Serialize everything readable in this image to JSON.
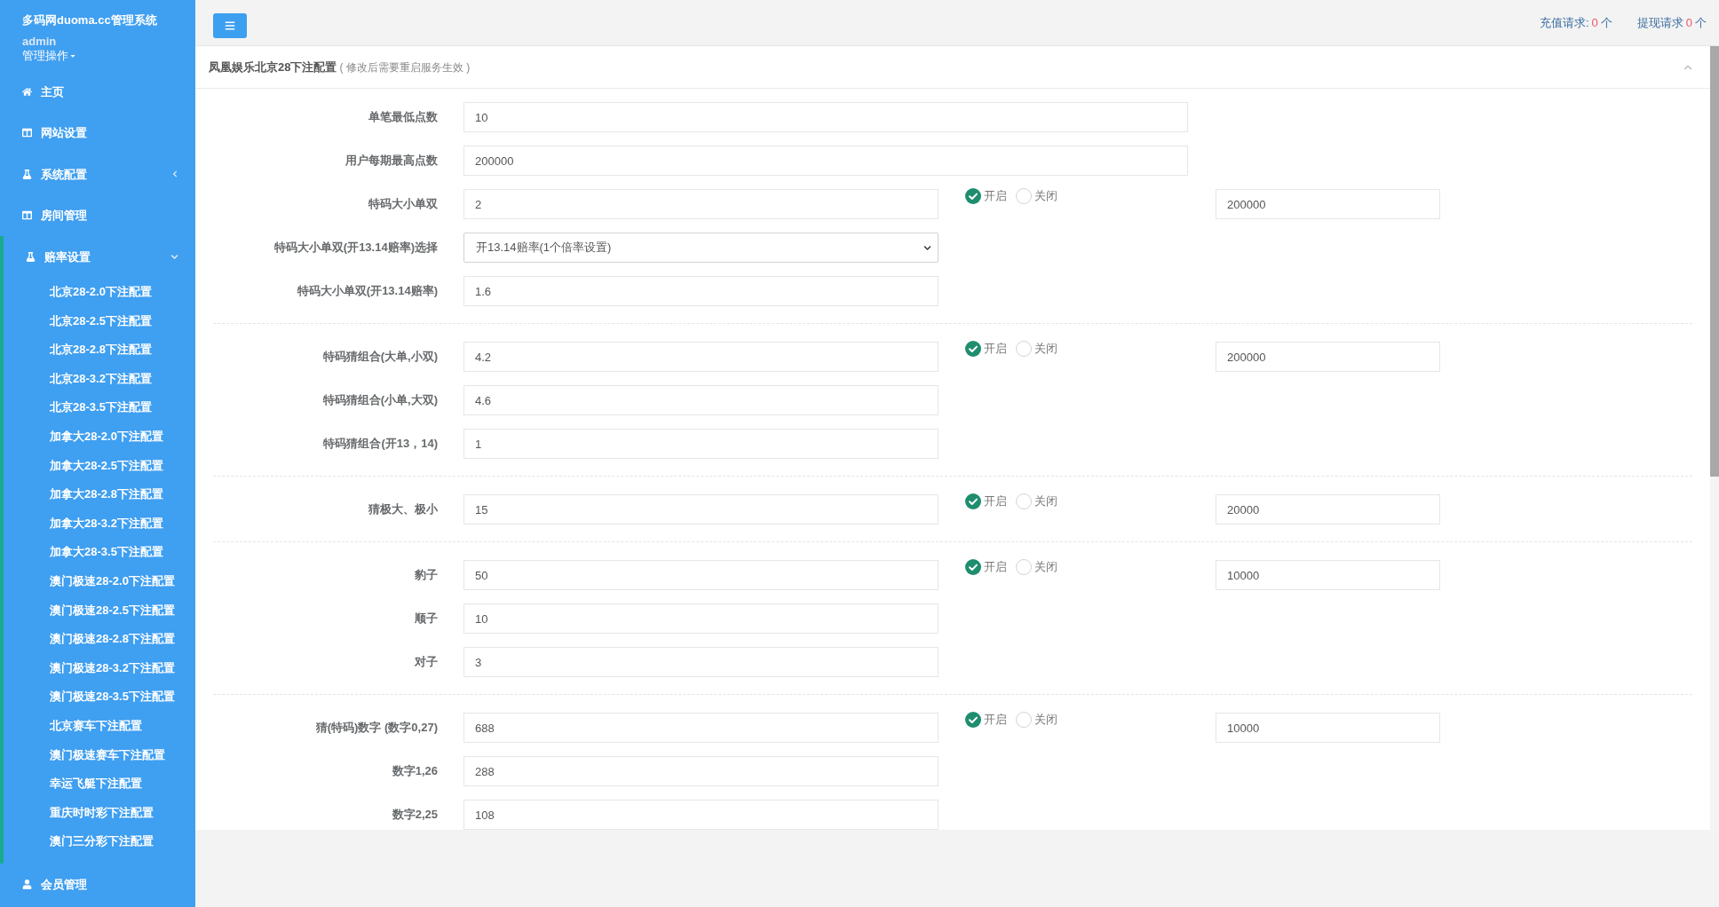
{
  "sidebar": {
    "brand": "多码网duoma.cc管理系统",
    "user": "admin",
    "user_menu": "管理操作",
    "items": [
      {
        "label": "主页",
        "kind": "link"
      },
      {
        "label": "网站设置",
        "kind": "link"
      },
      {
        "label": "系统配置",
        "kind": "menu",
        "expanded": false
      },
      {
        "label": "房间管理",
        "kind": "link"
      },
      {
        "label": "赔率设置",
        "kind": "menu",
        "expanded": true,
        "children": [
          {
            "label": "北京28-2.0下注配置"
          },
          {
            "label": "北京28-2.5下注配置"
          },
          {
            "label": "北京28-2.8下注配置"
          },
          {
            "label": "北京28-3.2下注配置"
          },
          {
            "label": "北京28-3.5下注配置"
          },
          {
            "label": "加拿大28-2.0下注配置"
          },
          {
            "label": "加拿大28-2.5下注配置"
          },
          {
            "label": "加拿大28-2.8下注配置"
          },
          {
            "label": "加拿大28-3.2下注配置"
          },
          {
            "label": "加拿大28-3.5下注配置"
          },
          {
            "label": "澳门极速28-2.0下注配置"
          },
          {
            "label": "澳门极速28-2.5下注配置"
          },
          {
            "label": "澳门极速28-2.8下注配置"
          },
          {
            "label": "澳门极速28-3.2下注配置"
          },
          {
            "label": "澳门极速28-3.5下注配置"
          },
          {
            "label": "北京赛车下注配置"
          },
          {
            "label": "澳门极速赛车下注配置"
          },
          {
            "label": "幸运飞艇下注配置"
          },
          {
            "label": "重庆时时彩下注配置"
          },
          {
            "label": "澳门三分彩下注配置"
          }
        ]
      },
      {
        "label": "会员管理",
        "kind": "link"
      }
    ]
  },
  "topbar": {
    "requests": [
      {
        "label": "充值请求:",
        "count": "0",
        "unit": "个"
      },
      {
        "label": "提现请求",
        "count": "0",
        "unit": "个"
      }
    ]
  },
  "panel": {
    "title": "凤凰娱乐北京28下注配置",
    "note": "( 修改后需要重启服务生效 )",
    "general": [
      {
        "label": "单笔最低点数",
        "value": "10"
      },
      {
        "label": "用户每期最高点数",
        "value": "200000"
      }
    ],
    "groups": [
      {
        "rows": [
          {
            "label": "特码大小单双",
            "kind": "input",
            "value": "2"
          },
          {
            "label": "特码大小单双(开13.14赔率)选择",
            "kind": "select",
            "value": "开13.14赔率(1个倍率设置)"
          },
          {
            "label": "特码大小单双(开13.14赔率)",
            "kind": "input",
            "value": "1.6"
          }
        ],
        "switch": [
          {
            "label": "开启",
            "selected": true
          },
          {
            "label": "关闭",
            "selected": false
          }
        ],
        "limit": "200000"
      },
      {
        "rows": [
          {
            "label": "特码猜组合(大单,小双)",
            "kind": "input",
            "value": "4.2"
          },
          {
            "label": "特码猜组合(小单,大双)",
            "kind": "input",
            "value": "4.6"
          },
          {
            "label": "特码猜组合(开13，14)",
            "kind": "input",
            "value": "1"
          }
        ],
        "switch": [
          {
            "label": "开启",
            "selected": true
          },
          {
            "label": "关闭",
            "selected": false
          }
        ],
        "limit": "200000"
      },
      {
        "rows": [
          {
            "label": "猜极大、极小",
            "kind": "input",
            "value": "15"
          }
        ],
        "switch": [
          {
            "label": "开启",
            "selected": true
          },
          {
            "label": "关闭",
            "selected": false
          }
        ],
        "limit": "20000"
      },
      {
        "rows": [
          {
            "label": "豹子",
            "kind": "input",
            "value": "50"
          },
          {
            "label": "顺子",
            "kind": "input",
            "value": "10"
          },
          {
            "label": "对子",
            "kind": "input",
            "value": "3"
          }
        ],
        "switch": [
          {
            "label": "开启",
            "selected": true
          },
          {
            "label": "关闭",
            "selected": false
          }
        ],
        "limit": "10000"
      },
      {
        "rows": [
          {
            "label": "猜(特码)数字 (数字0,27)",
            "kind": "input",
            "value": "688"
          },
          {
            "label": "数字1,26",
            "kind": "input",
            "value": "288"
          },
          {
            "label": "数字2,25",
            "kind": "input",
            "value": "108"
          }
        ],
        "switch": [
          {
            "label": "开启",
            "selected": true
          },
          {
            "label": "关闭",
            "selected": false
          }
        ],
        "limit": "10000"
      }
    ]
  }
}
